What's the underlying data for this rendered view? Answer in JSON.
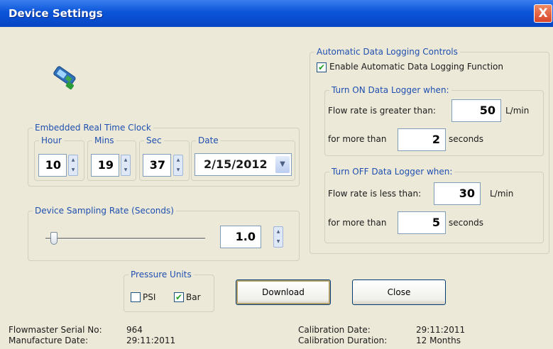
{
  "window": {
    "title": "Device Settings",
    "close_glyph": "X"
  },
  "device_icon": "handheld-device-icon",
  "clock": {
    "legend": "Embedded Real Time Clock",
    "hour_label": "Hour",
    "hour_value": "10",
    "mins_label": "Mins",
    "mins_value": "19",
    "sec_label": "Sec",
    "sec_value": "37",
    "date_label": "Date",
    "date_value": "2/15/2012"
  },
  "sampling": {
    "legend": "Device Sampling Rate (Seconds)",
    "value": "1.0",
    "slider_position": 0.03
  },
  "logging": {
    "legend": "Automatic Data Logging Controls",
    "enable_label": "Enable Automatic Data Logging Function",
    "enable_checked": true,
    "on": {
      "legend": "Turn ON Data Logger when:",
      "flow_label": "Flow rate is greater than:",
      "flow_value": "50",
      "flow_unit": "L/min",
      "time_label": "for more than",
      "time_value": "2",
      "time_unit": "seconds"
    },
    "off": {
      "legend": "Turn OFF Data Logger when:",
      "flow_label": "Flow rate is less than:",
      "flow_value": "30",
      "flow_unit": "L/min",
      "time_label": "for more than",
      "time_value": "5",
      "time_unit": "seconds"
    }
  },
  "pressure": {
    "legend": "Pressure Units",
    "psi_label": "PSI",
    "psi_checked": false,
    "bar_label": "Bar",
    "bar_checked": true
  },
  "buttons": {
    "download": "Download",
    "close": "Close"
  },
  "info": {
    "serial_label": "Flowmaster Serial No:",
    "serial_value": "964",
    "manufacture_label": "Manufacture Date:",
    "manufacture_value": "29:11:2011",
    "calibration_label": "Calibration Date:",
    "calibration_value": "29:11:2011",
    "duration_label": "Calibration Duration:",
    "duration_value": "12 Months"
  },
  "colors": {
    "title_bar": "#0a54d8",
    "group_label": "#1f4fb0",
    "window_bg": "#ece9d8"
  }
}
